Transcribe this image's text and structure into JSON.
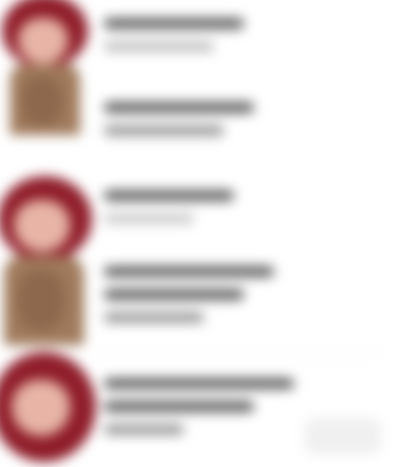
{
  "entries": [
    {
      "lines": [
        "",
        ""
      ]
    },
    {
      "lines": [
        "",
        ""
      ]
    },
    {
      "lines": [
        "",
        ""
      ]
    },
    {
      "lines": [
        "",
        "",
        ""
      ]
    },
    {
      "lines": [
        "",
        "",
        ""
      ]
    }
  ],
  "action": {
    "label": ""
  },
  "colors": {
    "hair": "#8f1d2a",
    "skin": "#e7b4a6",
    "clothing": "#a07a5c",
    "text": "#5e5e5e"
  },
  "icons": {
    "entry_art": "character-portrait-icon"
  }
}
